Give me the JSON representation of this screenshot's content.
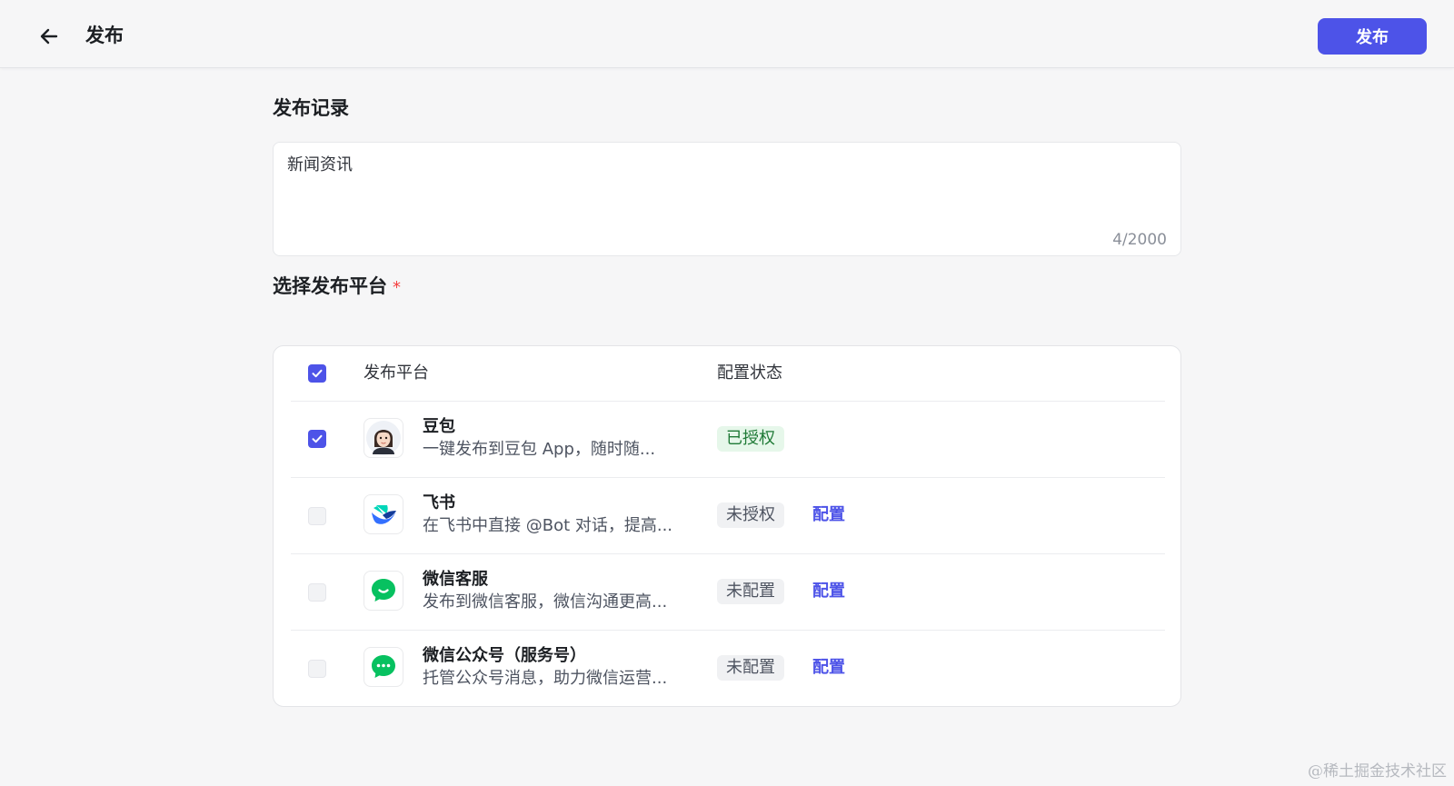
{
  "header": {
    "title": "发布",
    "publish_label": "发布"
  },
  "record": {
    "title": "发布记录",
    "value": "新闻资讯",
    "count": "4/2000"
  },
  "platforms": {
    "title": "选择发布平台",
    "required_mark": "*",
    "columns": {
      "platform": "发布平台",
      "status": "配置状态"
    },
    "select_all_checked": true,
    "items": [
      {
        "name": "豆包",
        "desc": "一键发布到豆包 App，随时随...",
        "status": "已授权",
        "status_kind": "ok",
        "checked": true,
        "config_label": "",
        "icon": "doubao-avatar-icon"
      },
      {
        "name": "飞书",
        "desc": "在飞书中直接 @Bot 对话，提高...",
        "status": "未授权",
        "status_kind": "no",
        "checked": false,
        "config_label": "配置",
        "icon": "feishu-icon"
      },
      {
        "name": "微信客服",
        "desc": "发布到微信客服，微信沟通更高...",
        "status": "未配置",
        "status_kind": "no",
        "checked": false,
        "config_label": "配置",
        "icon": "wechat-service-icon"
      },
      {
        "name": "微信公众号（服务号）",
        "desc": "托管公众号消息，助力微信运营...",
        "status": "未配置",
        "status_kind": "no",
        "checked": false,
        "config_label": "配置",
        "icon": "wechat-official-icon"
      }
    ]
  },
  "colors": {
    "accent": "#4d53e8",
    "success_bg": "#e6f7ea",
    "wechat_green": "#07c160"
  },
  "watermark": "@稀土掘金技术社区"
}
